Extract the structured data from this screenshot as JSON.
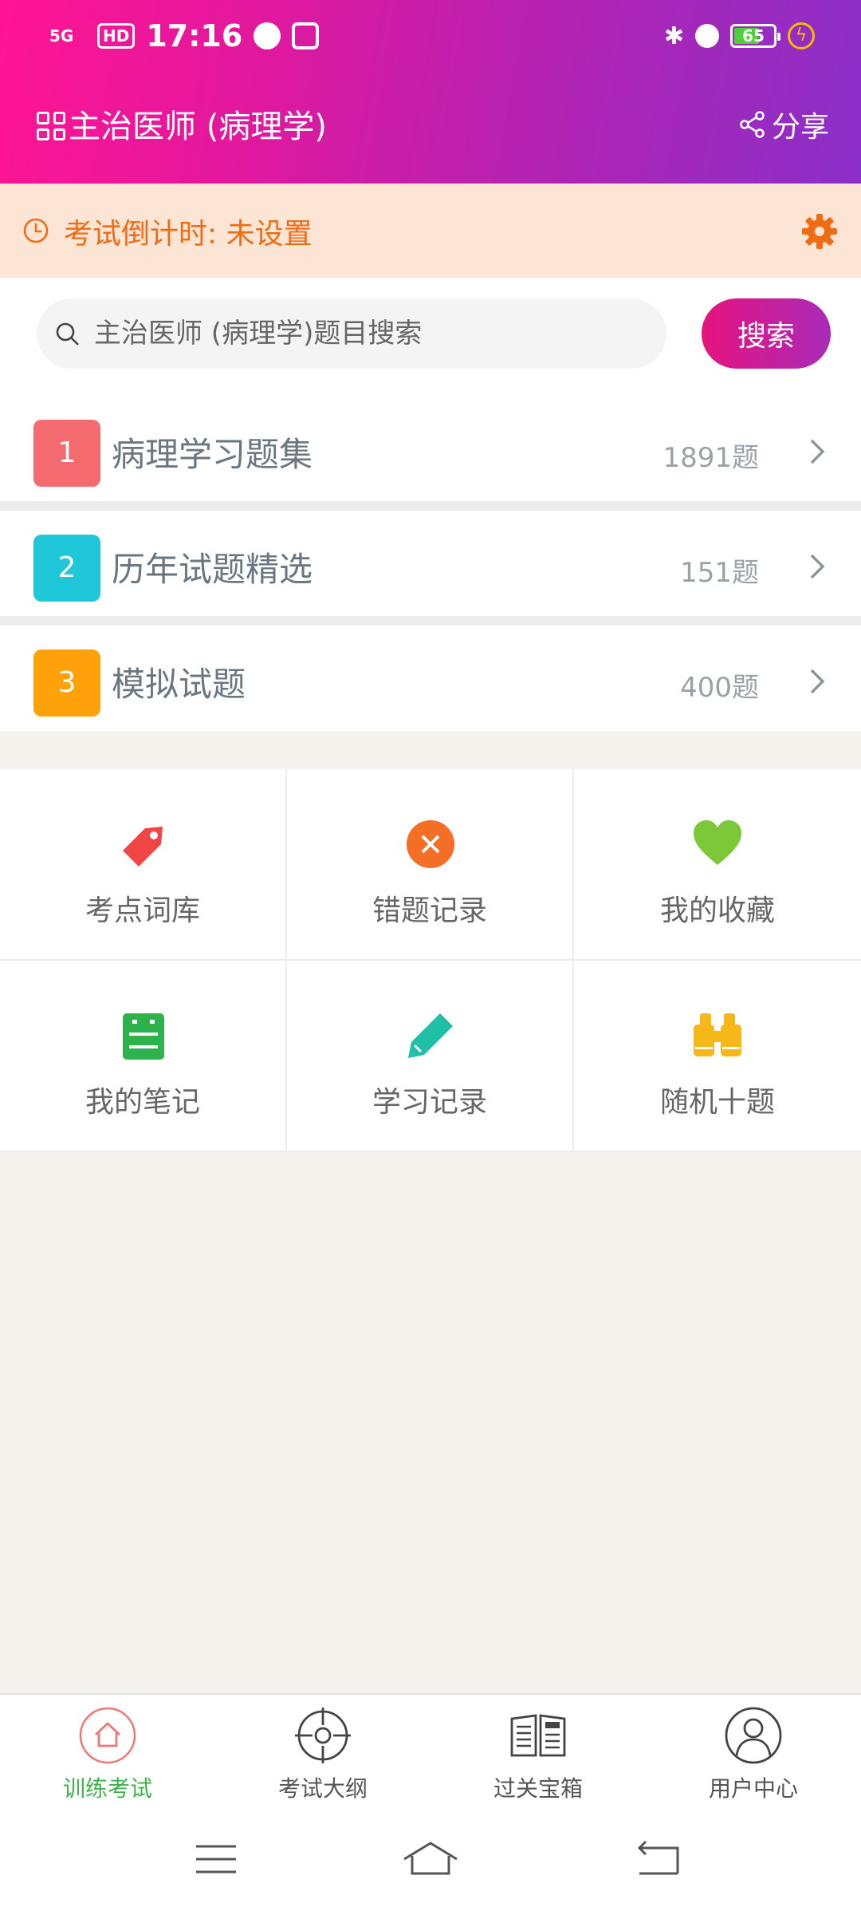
{
  "status_bar": {
    "network": "5G",
    "hd": "HD",
    "time": "17:16",
    "battery": "65"
  },
  "header": {
    "title": "主治医师 (病理学)",
    "share_label": "分享"
  },
  "countdown": {
    "text": "考试倒计时: 未设置"
  },
  "search": {
    "placeholder": "主治医师 (病理学)题目搜索",
    "button_label": "搜索"
  },
  "question_sets": [
    {
      "number": "1",
      "title": "病理学习题集",
      "count": "1891题",
      "color": "#f46b6f"
    },
    {
      "number": "2",
      "title": "历年试题精选",
      "count": "151题",
      "color": "#1fc7d8"
    },
    {
      "number": "3",
      "title": "模拟试题",
      "count": "400题",
      "color": "#ffa10a"
    }
  ],
  "tools": [
    {
      "label": "考点词库",
      "icon": "tag-icon",
      "color": "#ef4545"
    },
    {
      "label": "错题记录",
      "icon": "wrong-circle-icon",
      "color": "#f46f25"
    },
    {
      "label": "我的收藏",
      "icon": "heart-icon",
      "color": "#7dc838"
    },
    {
      "label": "我的笔记",
      "icon": "notebook-icon",
      "color": "#2eb24b"
    },
    {
      "label": "学习记录",
      "icon": "pencil-icon",
      "color": "#1fc0a6"
    },
    {
      "label": "随机十题",
      "icon": "binoculars-icon",
      "color": "#f6b719"
    }
  ],
  "bottom_nav": [
    {
      "label": "训练考试",
      "icon": "home-icon",
      "active": true
    },
    {
      "label": "考试大纲",
      "icon": "target-icon",
      "active": false
    },
    {
      "label": "过关宝箱",
      "icon": "news-icon",
      "active": false
    },
    {
      "label": "用户中心",
      "icon": "user-icon",
      "active": false
    }
  ],
  "colors": {
    "header_gradient_start": "#ff1493",
    "header_gradient_end": "#8a2fc8",
    "countdown_bg": "#fde5d6",
    "countdown_text": "#ef6c13",
    "active_nav": "#3fb24b"
  }
}
